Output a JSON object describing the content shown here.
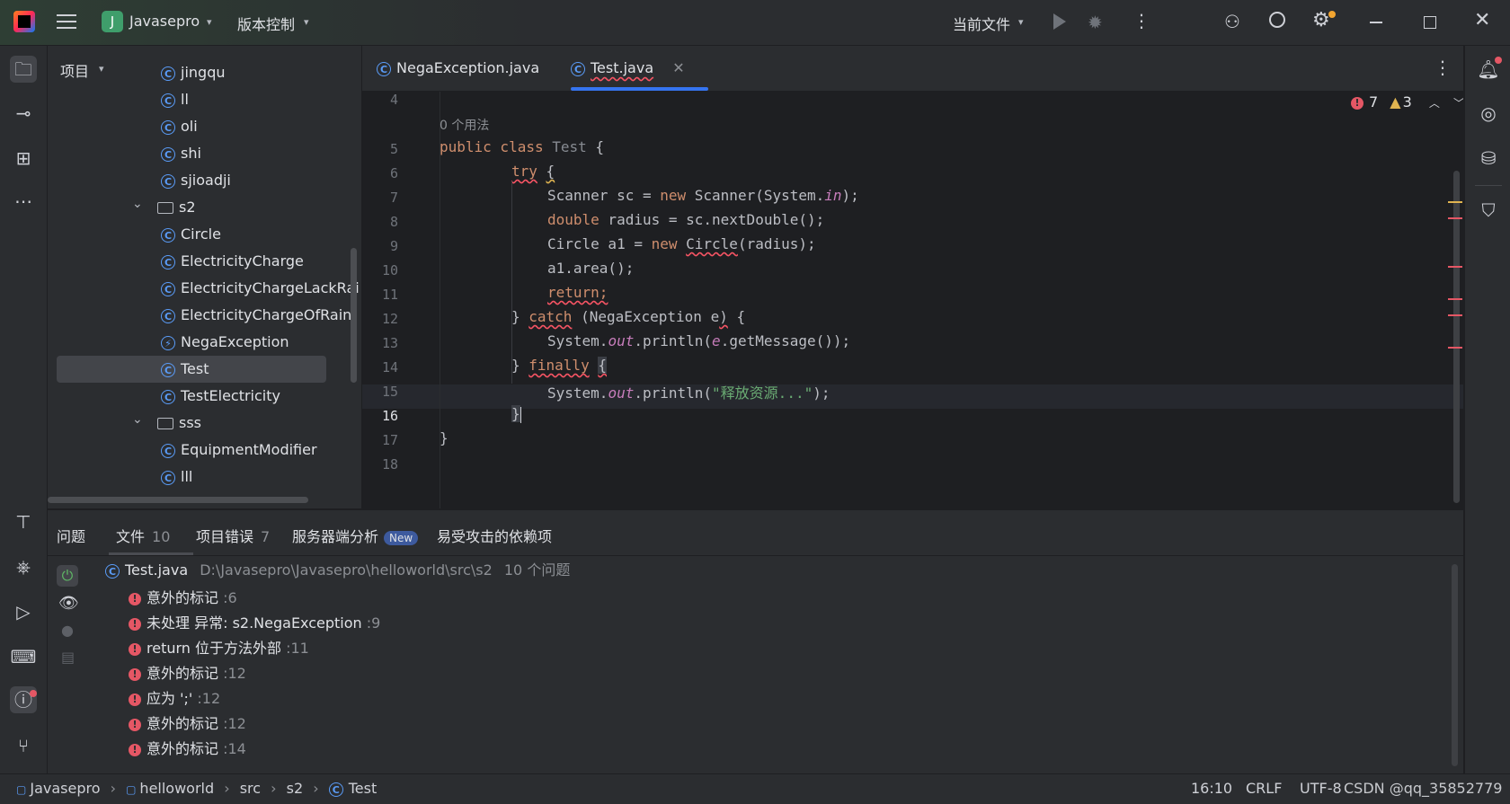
{
  "titlebar": {
    "project_initial": "J",
    "project_name": "Javasepro",
    "vcs_label": "版本控制",
    "run_config": "当前文件"
  },
  "project_panel": {
    "title": "项目",
    "items": [
      {
        "label": "jingqu",
        "kind": "class",
        "indent": 2
      },
      {
        "label": "ll",
        "kind": "class",
        "indent": 2
      },
      {
        "label": "oli",
        "kind": "class",
        "indent": 2
      },
      {
        "label": "shi",
        "kind": "class",
        "indent": 2
      },
      {
        "label": "sjioadji",
        "kind": "class",
        "indent": 2
      },
      {
        "label": "s2",
        "kind": "package",
        "indent": 1
      },
      {
        "label": "Circle",
        "kind": "class",
        "indent": 2
      },
      {
        "label": "ElectricityCharge",
        "kind": "class",
        "indent": 2
      },
      {
        "label": "ElectricityChargeLackRai",
        "kind": "class",
        "indent": 2
      },
      {
        "label": "ElectricityChargeOfRain",
        "kind": "class",
        "indent": 2
      },
      {
        "label": "NegaException",
        "kind": "exception",
        "indent": 2
      },
      {
        "label": "Test",
        "kind": "class",
        "indent": 2,
        "selected": true
      },
      {
        "label": "TestElectricity",
        "kind": "class",
        "indent": 2
      },
      {
        "label": "sss",
        "kind": "package",
        "indent": 1
      },
      {
        "label": "EquipmentModifier",
        "kind": "class",
        "indent": 2
      },
      {
        "label": "lll",
        "kind": "class",
        "indent": 2
      }
    ]
  },
  "tabs": [
    {
      "label": "NegaException.java",
      "active": false
    },
    {
      "label": "Test.java",
      "active": true
    }
  ],
  "inspections": {
    "errors": "7",
    "warnings": "3"
  },
  "editor": {
    "usages_hint": "0 个用法",
    "line_numbers": [
      "4",
      "5",
      "6",
      "7",
      "8",
      "9",
      "10",
      "11",
      "12",
      "13",
      "14",
      "15",
      "16",
      "17",
      "18"
    ],
    "current_line": "16"
  },
  "bottom_panel": {
    "tabs": [
      {
        "label": "问题",
        "count": ""
      },
      {
        "label": "文件",
        "count": "10"
      },
      {
        "label": "项目错误",
        "count": "7"
      },
      {
        "label": "服务器端分析",
        "count": "",
        "badge": "New"
      },
      {
        "label": "易受攻击的依赖项",
        "count": ""
      }
    ],
    "file_row": {
      "name": "Test.java",
      "path": "D:\\Javasepro\\Javasepro\\helloworld\\src\\s2",
      "summary": "10 个问题"
    },
    "issues": [
      {
        "text": "意外的标记",
        "loc": ":6"
      },
      {
        "text": "未处理 异常: s2.NegaException",
        "loc": ":9"
      },
      {
        "text": "return 位于方法外部",
        "loc": ":11"
      },
      {
        "text": "意外的标记",
        "loc": ":12"
      },
      {
        "text": "应为 ';'",
        "loc": ":12"
      },
      {
        "text": "意外的标记",
        "loc": ":12"
      },
      {
        "text": "意外的标记",
        "loc": ":14"
      }
    ]
  },
  "statusbar": {
    "crumbs": [
      "Javasepro",
      "helloworld",
      "src",
      "s2",
      "Test"
    ],
    "position": "16:10",
    "line_sep": "CRLF",
    "encoding": "UTF-8",
    "watermark": "CSDN @qq_35852779"
  },
  "colors": {
    "accent": "#3574f0",
    "error": "#e55765",
    "warning": "#e0b450"
  }
}
